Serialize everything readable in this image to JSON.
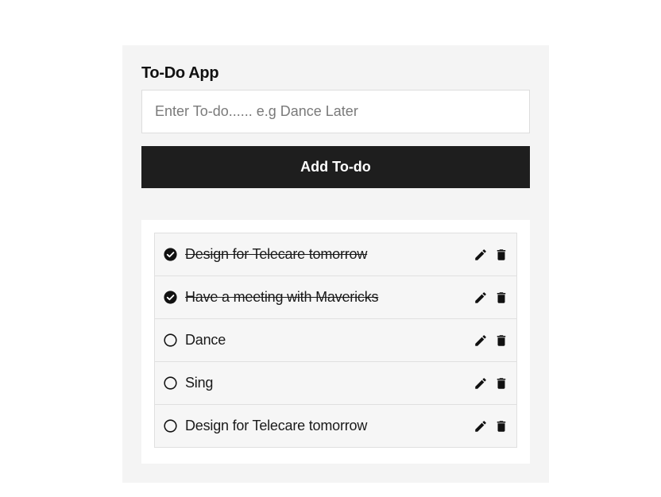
{
  "app": {
    "title": "To-Do App"
  },
  "form": {
    "input_value": "",
    "input_placeholder": "Enter To-do...... e.g Dance Later",
    "add_button_label": "Add To-do"
  },
  "todos": [
    {
      "text": "Design for Telecare tomorrow",
      "completed": true
    },
    {
      "text": "Have a meeting with Mavericks",
      "completed": true
    },
    {
      "text": "Dance",
      "completed": false
    },
    {
      "text": "Sing",
      "completed": false
    },
    {
      "text": "Design for Telecare tomorrow",
      "completed": false
    }
  ],
  "icons": {
    "completed": "check-circle-icon",
    "pending": "circle-icon",
    "edit": "pencil-icon",
    "delete": "trash-icon"
  },
  "colors": {
    "panel_background": "#f4f4f4",
    "button_background": "#1e1e1e",
    "button_text": "#ffffff",
    "item_background": "#f6f6f6",
    "text": "#1a1a1a"
  }
}
